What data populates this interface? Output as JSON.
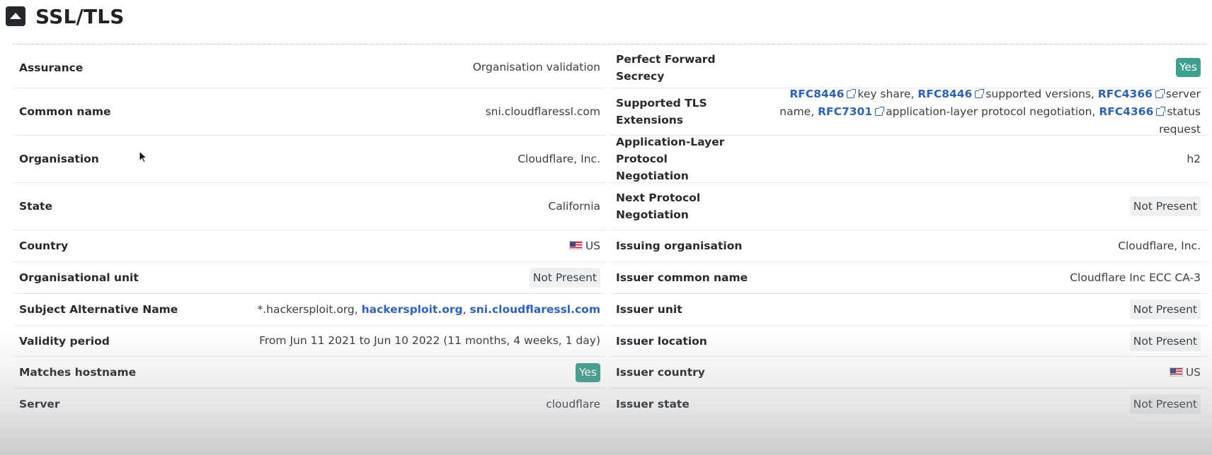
{
  "header": {
    "title": "SSL/TLS"
  },
  "left_rows": [
    {
      "label": "Assurance",
      "value": "Organisation validation"
    },
    {
      "label": "Common name",
      "value": "sni.cloudflaressl.com"
    },
    {
      "label": "Organisation",
      "value": "Cloudflare, Inc."
    },
    {
      "label": "State",
      "value": "California"
    },
    {
      "label": "Country",
      "value": "US"
    },
    {
      "label": "Organisational unit",
      "value": "Not Present"
    },
    {
      "label": "Subject Alternative Name",
      "value_prefix": "*.hackersploit.org,",
      "link1": "hackersploit.org",
      "sep": ",",
      "link2": "sni.cloudflaressl.com"
    },
    {
      "label": "Validity period",
      "value": "From Jun 11 2021 to Jun 10 2022 (11 months, 4 weeks, 1 day)"
    },
    {
      "label": "Matches hostname",
      "value": "Yes"
    },
    {
      "label": "Server",
      "value": "cloudflare"
    }
  ],
  "right_rows": [
    {
      "label": "Perfect Forward Secrecy",
      "value": "Yes"
    },
    {
      "label": "Supported TLS Extensions",
      "ext1": "RFC8446",
      "ext1_text": "key share,",
      "ext2": "RFC8446",
      "ext2_text": "supported versions,",
      "ext3": "RFC4366",
      "ext3_text": "server name,",
      "ext4": "RFC7301",
      "ext4_text": "application-layer protocol negotiation,",
      "ext5": "RFC4366",
      "ext5_text": "status request"
    },
    {
      "label": "Application-Layer Protocol Negotiation",
      "value": "h2"
    },
    {
      "label": "Next Protocol Negotiation",
      "value": "Not Present"
    },
    {
      "label": "Issuing organisation",
      "value": "Cloudflare, Inc."
    },
    {
      "label": "Issuer common name",
      "value": "Cloudflare Inc ECC CA-3"
    },
    {
      "label": "Issuer unit",
      "value": "Not Present"
    },
    {
      "label": "Issuer location",
      "value": "Not Present"
    },
    {
      "label": "Issuer country",
      "value": "US"
    },
    {
      "label": "Issuer state",
      "value": "Not Present"
    }
  ],
  "colors": {
    "accent_link": "#2e62b5",
    "yes_badge": "#3f9e8d",
    "not_present_bg": "#eef0f1"
  },
  "icons": {
    "collapse": "caret-up-icon",
    "flag": "us-flag-icon",
    "external": "external-link-icon"
  }
}
